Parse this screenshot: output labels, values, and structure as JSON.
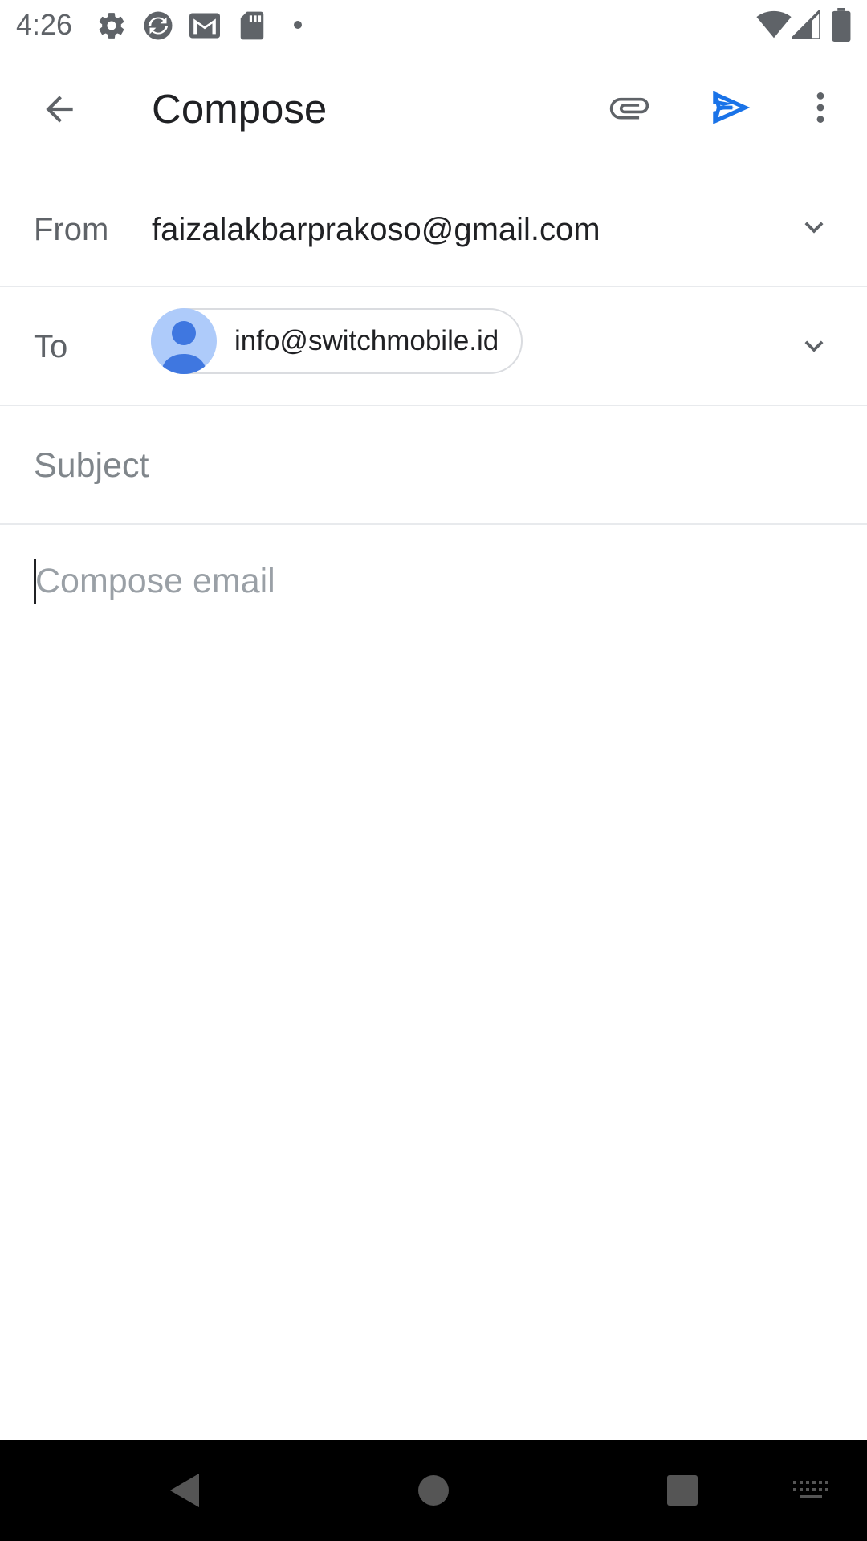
{
  "status_bar": {
    "time": "4:26",
    "left_icons": [
      "settings-icon",
      "sync-icon",
      "gmail-icon",
      "sd-card-icon",
      "notification-dot-icon"
    ],
    "right_icons": [
      "wifi-icon",
      "cellular-signal-icon",
      "battery-icon"
    ]
  },
  "app_bar": {
    "title": "Compose",
    "back_icon": "arrow-back-icon",
    "attach_icon": "paperclip-icon",
    "send_icon": "send-icon",
    "more_icon": "more-vertical-icon"
  },
  "from": {
    "label": "From",
    "value": "faizalakbarprakoso@gmail.com"
  },
  "to": {
    "label": "To",
    "recipients": [
      {
        "email": "info@switchmobile.id",
        "avatar": "person-icon"
      }
    ]
  },
  "subject": {
    "placeholder": "Subject",
    "value": ""
  },
  "body": {
    "placeholder": "Compose email",
    "value": ""
  },
  "nav_bar": {
    "buttons": [
      "back-triangle-icon",
      "home-circle-icon",
      "recents-square-icon",
      "keyboard-icon"
    ]
  },
  "colors": {
    "accent": "#1a73e8",
    "text_primary": "#202124",
    "text_secondary": "#5f6368",
    "avatar_bg": "#aecbfa",
    "avatar_fg": "#3f77e0",
    "divider": "#e8eaed",
    "nav_bg": "#000000"
  }
}
